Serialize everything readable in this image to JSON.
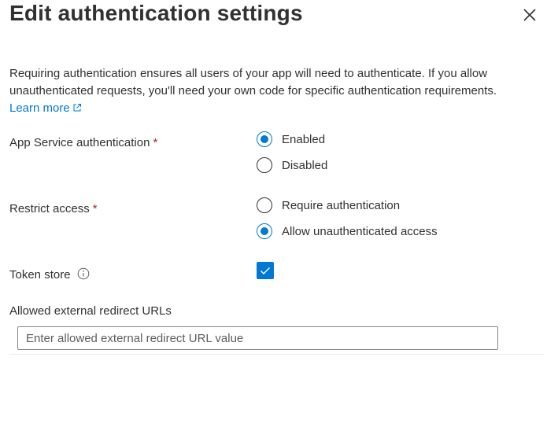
{
  "dialog": {
    "title": "Edit authentication settings",
    "description": "Requiring authentication ensures all users of your app will need to authenticate. If you allow unauthenticated requests, you'll need your own code for specific authentication requirements.",
    "learn_more": "Learn more"
  },
  "fields": {
    "app_service_auth": {
      "label": "App Service authentication",
      "required_marker": "*",
      "options": [
        "Enabled",
        "Disabled"
      ],
      "selected": "Enabled"
    },
    "restrict_access": {
      "label": "Restrict access",
      "required_marker": "*",
      "options": [
        "Require authentication",
        "Allow unauthenticated access"
      ],
      "selected": "Allow unauthenticated access"
    },
    "token_store": {
      "label": "Token store",
      "checked": true
    },
    "redirect_urls": {
      "label": "Allowed external redirect URLs",
      "value": "",
      "placeholder": "Enter allowed external redirect URL value"
    }
  },
  "colors": {
    "accent": "#0078d4",
    "required": "#a4262c",
    "text": "#323130"
  },
  "icons": {
    "close": "close-icon",
    "external_link": "external-link-icon",
    "info": "info-icon",
    "check": "checkmark-icon"
  }
}
